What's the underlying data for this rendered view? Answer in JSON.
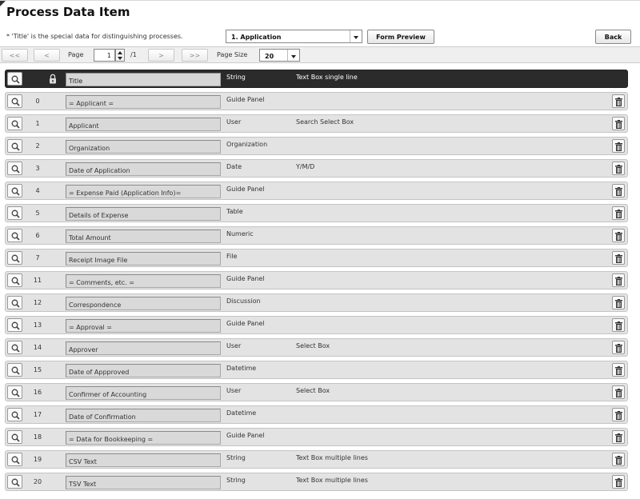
{
  "header": {
    "title": "Process Data Item",
    "note": "* 'Title' is the special data for distinguishing processes."
  },
  "controls": {
    "form_select_value": "1. Application",
    "form_preview_label": "Form Preview",
    "back_label": "Back"
  },
  "pager": {
    "first_label": "<<",
    "prev_label": "<",
    "page_label": "Page",
    "page_value": "1",
    "page_total": "/1",
    "next_label": ">",
    "last_label": ">>",
    "page_size_label": "Page Size",
    "page_size_value": "20"
  },
  "header_row": {
    "title": "Title",
    "type": "String",
    "desc": "Text Box single line"
  },
  "rows": [
    {
      "num": "0",
      "title": "= Applicant =",
      "type": "Guide Panel",
      "desc": ""
    },
    {
      "num": "1",
      "title": "Applicant",
      "type": "User",
      "desc": "Search Select Box"
    },
    {
      "num": "2",
      "title": "Organization",
      "type": "Organization",
      "desc": ""
    },
    {
      "num": "3",
      "title": "Date of Application",
      "type": "Date",
      "desc": "Y/M/D"
    },
    {
      "num": "4",
      "title": "= Expense Paid (Application Info)=",
      "type": "Guide Panel",
      "desc": ""
    },
    {
      "num": "5",
      "title": "Details of Expense",
      "type": "Table",
      "desc": ""
    },
    {
      "num": "6",
      "title": "Total Amount",
      "type": "Numeric",
      "desc": ""
    },
    {
      "num": "7",
      "title": "Receipt Image File",
      "type": "File",
      "desc": ""
    },
    {
      "num": "11",
      "title": "= Comments, etc. =",
      "type": "Guide Panel",
      "desc": ""
    },
    {
      "num": "12",
      "title": "Correspondence",
      "type": "Discussion",
      "desc": ""
    },
    {
      "num": "13",
      "title": "= Approval =",
      "type": "Guide Panel",
      "desc": ""
    },
    {
      "num": "14",
      "title": "Approver",
      "type": "User",
      "desc": "Select Box"
    },
    {
      "num": "15",
      "title": "Date of Appproved",
      "type": "Datetime",
      "desc": ""
    },
    {
      "num": "16",
      "title": "Confirmer of Accounting",
      "type": "User",
      "desc": "Select Box"
    },
    {
      "num": "17",
      "title": "Date of Confirmation",
      "type": "Datetime",
      "desc": ""
    },
    {
      "num": "18",
      "title": "= Data for Bookkeeping =",
      "type": "Guide Panel",
      "desc": ""
    },
    {
      "num": "19",
      "title": "CSV Text",
      "type": "String",
      "desc": "Text Box multiple lines"
    },
    {
      "num": "20",
      "title": "TSV Text",
      "type": "String",
      "desc": "Text Box multiple lines"
    }
  ],
  "icons": {
    "search": "magnifier-icon",
    "delete": "trash-icon",
    "lock": "lock-icon"
  }
}
